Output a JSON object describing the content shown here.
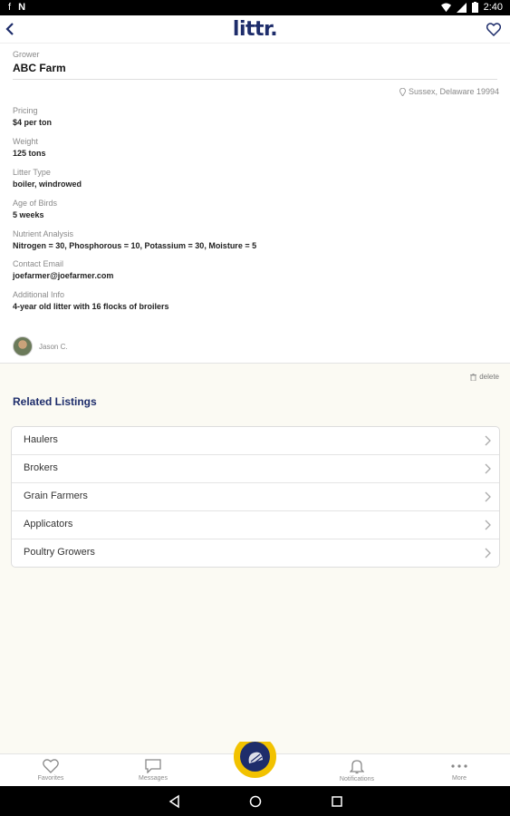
{
  "status_bar": {
    "time": "2:40",
    "left_glyphs": [
      "f",
      "N"
    ]
  },
  "app": {
    "logo": "littr."
  },
  "grower": {
    "label": "Grower",
    "name": "ABC Farm"
  },
  "location": "Sussex, Delaware 19994",
  "fields": [
    {
      "label": "Pricing",
      "value": "$4 per ton"
    },
    {
      "label": "Weight",
      "value": "125 tons"
    },
    {
      "label": "Litter Type",
      "value": "boiler, windrowed"
    },
    {
      "label": "Age of Birds",
      "value": "5 weeks"
    },
    {
      "label": "Nutrient Analysis",
      "value": "Nitrogen = 30, Phosphorous = 10, Potassium = 30, Moisture = 5"
    },
    {
      "label": "Contact Email",
      "value": "joefarmer@joefarmer.com"
    },
    {
      "label": "Additional Info",
      "value": "4-year old litter with 16 flocks of broilers"
    }
  ],
  "seller": {
    "name": "Jason C."
  },
  "delete_label": "delete",
  "related": {
    "title": "Related Listings",
    "items": [
      "Haulers",
      "Brokers",
      "Grain Farmers",
      "Applicators",
      "Poultry Growers"
    ]
  },
  "bottom_nav": {
    "favorites": "Favorites",
    "messages": "Messages",
    "notifications": "Notifications",
    "more": "More"
  },
  "colors": {
    "brand": "#1e2d6b",
    "accent": "#f2c200",
    "lower_bg": "#fbfaf3"
  },
  "icons": [
    "back-arrow-icon",
    "heart-icon",
    "location-pin-icon",
    "trash-icon",
    "chevron-right-icon",
    "chat-bubble-icon",
    "bell-icon",
    "more-dots-icon"
  ]
}
